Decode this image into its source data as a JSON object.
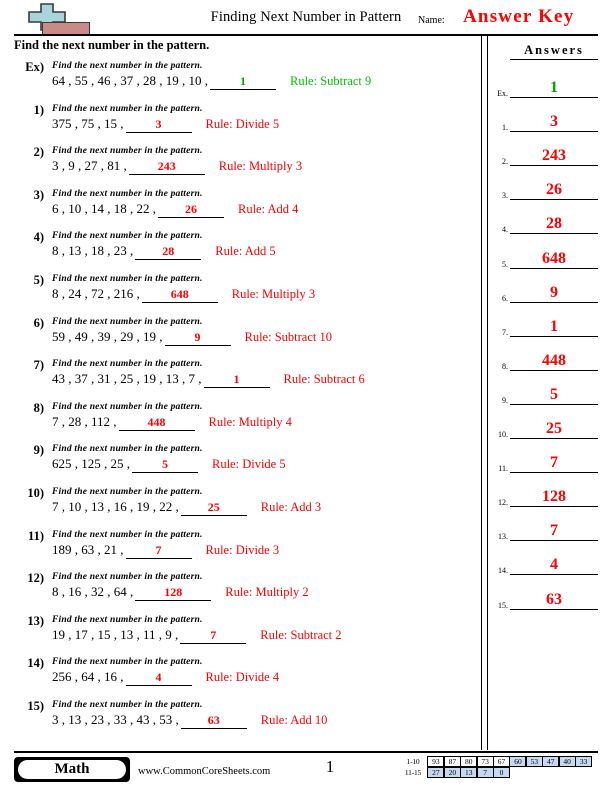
{
  "header": {
    "title": "Finding Next Number in Pattern",
    "name_label": "Name:",
    "answer_key": "Answer Key",
    "logo_icon": "plus-block-logo"
  },
  "instruction": "Find the next number in the pattern.",
  "problems": [
    {
      "num": "Ex)",
      "prompt": "Find the next number in the pattern.",
      "sequence": "64 , 55 , 46 , 37 , 28 , 19 , 10 ,",
      "answer": "1",
      "rule": "Rule: Subtract 9",
      "color": "green"
    },
    {
      "num": "1)",
      "prompt": "Find the next number in the pattern.",
      "sequence": "375 , 75 , 15 ,",
      "answer": "3",
      "rule": "Rule: Divide 5",
      "color": "red"
    },
    {
      "num": "2)",
      "prompt": "Find the next number in the pattern.",
      "sequence": "3 , 9 , 27 , 81 ,",
      "answer": "243",
      "rule": "Rule: Multiply 3",
      "color": "red"
    },
    {
      "num": "3)",
      "prompt": "Find the next number in the pattern.",
      "sequence": "6 , 10 , 14 , 18 , 22 ,",
      "answer": "26",
      "rule": "Rule: Add 4",
      "color": "red"
    },
    {
      "num": "4)",
      "prompt": "Find the next number in the pattern.",
      "sequence": "8 , 13 , 18 , 23 ,",
      "answer": "28",
      "rule": "Rule: Add 5",
      "color": "red"
    },
    {
      "num": "5)",
      "prompt": "Find the next number in the pattern.",
      "sequence": "8 , 24 , 72 , 216 ,",
      "answer": "648",
      "rule": "Rule: Multiply 3",
      "color": "red"
    },
    {
      "num": "6)",
      "prompt": "Find the next number in the pattern.",
      "sequence": "59 , 49 , 39 , 29 , 19 ,",
      "answer": "9",
      "rule": "Rule: Subtract 10",
      "color": "red"
    },
    {
      "num": "7)",
      "prompt": "Find the next number in the pattern.",
      "sequence": "43 , 37 , 31 , 25 , 19 , 13 , 7 ,",
      "answer": "1",
      "rule": "Rule: Subtract 6",
      "color": "red"
    },
    {
      "num": "8)",
      "prompt": "Find the next number in the pattern.",
      "sequence": "7 , 28 , 112 ,",
      "answer": "448",
      "rule": "Rule: Multiply 4",
      "color": "red"
    },
    {
      "num": "9)",
      "prompt": "Find the next number in the pattern.",
      "sequence": "625 , 125 , 25 ,",
      "answer": "5",
      "rule": "Rule: Divide 5",
      "color": "red"
    },
    {
      "num": "10)",
      "prompt": "Find the next number in the pattern.",
      "sequence": "7 , 10 , 13 , 16 , 19 , 22 ,",
      "answer": "25",
      "rule": "Rule: Add 3",
      "color": "red"
    },
    {
      "num": "11)",
      "prompt": "Find the next number in the pattern.",
      "sequence": "189 , 63 , 21 ,",
      "answer": "7",
      "rule": "Rule: Divide 3",
      "color": "red"
    },
    {
      "num": "12)",
      "prompt": "Find the next number in the pattern.",
      "sequence": "8 , 16 , 32 , 64 ,",
      "answer": "128",
      "rule": "Rule: Multiply 2",
      "color": "red"
    },
    {
      "num": "13)",
      "prompt": "Find the next number in the pattern.",
      "sequence": "19 , 17 , 15 , 13 , 11 , 9 ,",
      "answer": "7",
      "rule": "Rule: Subtract 2",
      "color": "red"
    },
    {
      "num": "14)",
      "prompt": "Find the next number in the pattern.",
      "sequence": "256 , 64 , 16 ,",
      "answer": "4",
      "rule": "Rule: Divide 4",
      "color": "red"
    },
    {
      "num": "15)",
      "prompt": "Find the next number in the pattern.",
      "sequence": "3 , 13 , 23 , 33 , 43 , 53 ,",
      "answer": "63",
      "rule": "Rule: Add 10",
      "color": "red"
    }
  ],
  "answers": {
    "title": "Answers",
    "rows": [
      {
        "label": "Ex.",
        "value": "1",
        "color": "green"
      },
      {
        "label": "1.",
        "value": "3",
        "color": "red"
      },
      {
        "label": "2.",
        "value": "243",
        "color": "red"
      },
      {
        "label": "3.",
        "value": "26",
        "color": "red"
      },
      {
        "label": "4.",
        "value": "28",
        "color": "red"
      },
      {
        "label": "5.",
        "value": "648",
        "color": "red"
      },
      {
        "label": "6.",
        "value": "9",
        "color": "red"
      },
      {
        "label": "7.",
        "value": "1",
        "color": "red"
      },
      {
        "label": "8.",
        "value": "448",
        "color": "red"
      },
      {
        "label": "9.",
        "value": "5",
        "color": "red"
      },
      {
        "label": "10.",
        "value": "25",
        "color": "red"
      },
      {
        "label": "11.",
        "value": "7",
        "color": "red"
      },
      {
        "label": "12.",
        "value": "128",
        "color": "red"
      },
      {
        "label": "13.",
        "value": "7",
        "color": "red"
      },
      {
        "label": "14.",
        "value": "4",
        "color": "red"
      },
      {
        "label": "15.",
        "value": "63",
        "color": "red"
      }
    ]
  },
  "footer": {
    "subject_badge": "Math",
    "site_url": "www.CommonCoreSheets.com",
    "page_number": "1",
    "scale": {
      "row1_label": "1-10",
      "row2_label": "11-15",
      "row1": [
        {
          "v": "93",
          "blue": false
        },
        {
          "v": "87",
          "blue": false
        },
        {
          "v": "80",
          "blue": false
        },
        {
          "v": "73",
          "blue": false
        },
        {
          "v": "67",
          "blue": false
        },
        {
          "v": "60",
          "blue": true
        },
        {
          "v": "53",
          "blue": true
        },
        {
          "v": "47",
          "blue": true
        },
        {
          "v": "40",
          "blue": true
        },
        {
          "v": "33",
          "blue": true
        }
      ],
      "row2": [
        {
          "v": "27",
          "blue": true
        },
        {
          "v": "20",
          "blue": true
        },
        {
          "v": "13",
          "blue": true
        },
        {
          "v": "7",
          "blue": true
        },
        {
          "v": "0",
          "blue": true
        }
      ]
    }
  },
  "colors": {
    "answer_red": "#ff0000",
    "example_green": "#00b000",
    "logo_blue": "#a8d5dd",
    "logo_red": "#c98b87",
    "scale_blue": "#c5d9f1"
  }
}
